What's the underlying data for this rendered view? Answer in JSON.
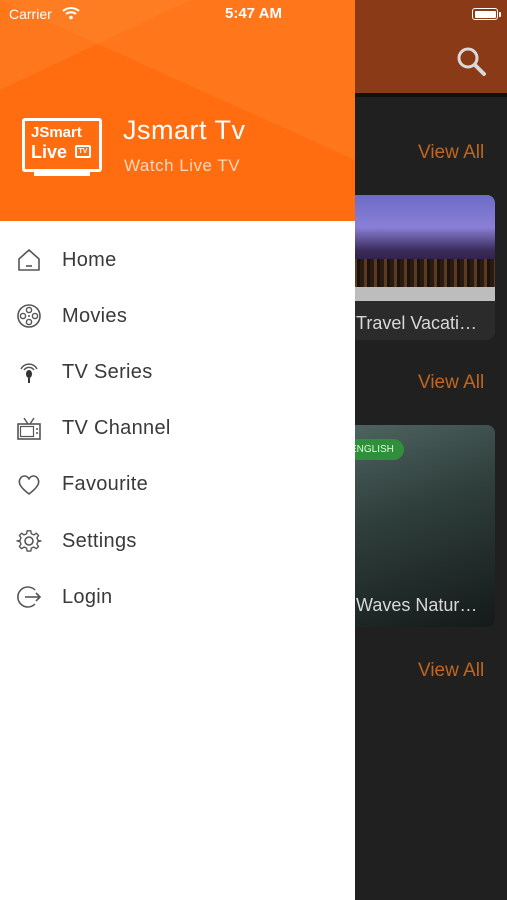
{
  "status_bar": {
    "carrier": "Carrier",
    "time": "5:47 AM"
  },
  "drawer": {
    "logo": {
      "line1": "JSmart",
      "line2": "Live"
    },
    "app_name": "Jsmart Tv",
    "subtitle": "Watch Live TV",
    "menu": [
      {
        "label": "Home",
        "icon": "home-icon"
      },
      {
        "label": "Movies",
        "icon": "film-reel-icon"
      },
      {
        "label": "TV Series",
        "icon": "broadcast-icon"
      },
      {
        "label": "TV Channel",
        "icon": "tv-icon"
      },
      {
        "label": "Favourite",
        "icon": "heart-icon"
      },
      {
        "label": "Settings",
        "icon": "gear-icon"
      },
      {
        "label": "Login",
        "icon": "login-icon"
      }
    ]
  },
  "background": {
    "view_all_label": "View All",
    "cards": [
      {
        "title": "Travel Vacati…"
      },
      {
        "title": "Waves Natur…",
        "badge": "ENGLISH"
      }
    ]
  },
  "colors": {
    "accent": "#ff6d10",
    "view_all": "#c0661f",
    "badge": "#2f8f3a"
  }
}
